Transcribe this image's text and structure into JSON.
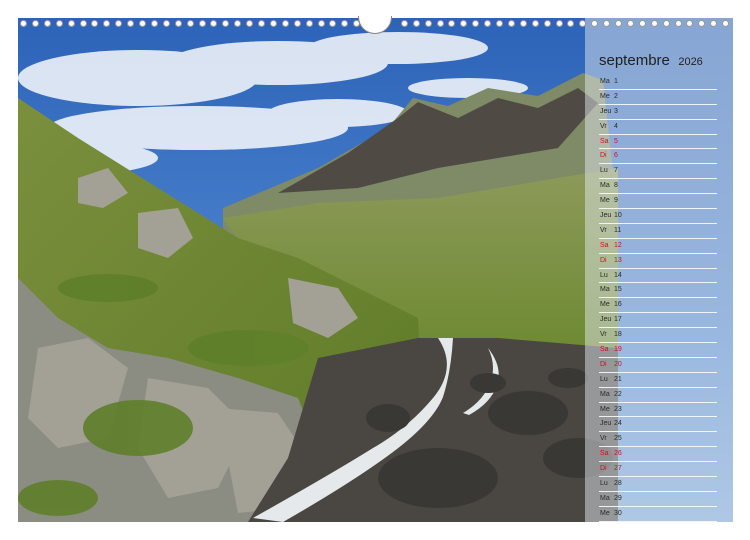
{
  "calendar": {
    "month": "septembre",
    "year": "2026",
    "weekend_color": "#c8141e",
    "text_color": "#2a2a2a",
    "days": [
      {
        "name": "Ma",
        "num": "1",
        "weekend": false
      },
      {
        "name": "Me",
        "num": "2",
        "weekend": false
      },
      {
        "name": "Jeu",
        "num": "3",
        "weekend": false
      },
      {
        "name": "Vr",
        "num": "4",
        "weekend": false
      },
      {
        "name": "Sa",
        "num": "5",
        "weekend": true
      },
      {
        "name": "Di",
        "num": "6",
        "weekend": true
      },
      {
        "name": "Lu",
        "num": "7",
        "weekend": false
      },
      {
        "name": "Ma",
        "num": "8",
        "weekend": false
      },
      {
        "name": "Me",
        "num": "9",
        "weekend": false
      },
      {
        "name": "Jeu",
        "num": "10",
        "weekend": false
      },
      {
        "name": "Vr",
        "num": "11",
        "weekend": false
      },
      {
        "name": "Sa",
        "num": "12",
        "weekend": true
      },
      {
        "name": "Di",
        "num": "13",
        "weekend": true
      },
      {
        "name": "Lu",
        "num": "14",
        "weekend": false
      },
      {
        "name": "Ma",
        "num": "15",
        "weekend": false
      },
      {
        "name": "Me",
        "num": "16",
        "weekend": false
      },
      {
        "name": "Jeu",
        "num": "17",
        "weekend": false
      },
      {
        "name": "Vr",
        "num": "18",
        "weekend": false
      },
      {
        "name": "Sa",
        "num": "19",
        "weekend": true
      },
      {
        "name": "Di",
        "num": "20",
        "weekend": true
      },
      {
        "name": "Lu",
        "num": "21",
        "weekend": false
      },
      {
        "name": "Ma",
        "num": "22",
        "weekend": false
      },
      {
        "name": "Me",
        "num": "23",
        "weekend": false
      },
      {
        "name": "Jeu",
        "num": "24",
        "weekend": false
      },
      {
        "name": "Vr",
        "num": "25",
        "weekend": false
      },
      {
        "name": "Sa",
        "num": "26",
        "weekend": true
      },
      {
        "name": "Di",
        "num": "27",
        "weekend": true
      },
      {
        "name": "Lu",
        "num": "28",
        "weekend": false
      },
      {
        "name": "Ma",
        "num": "29",
        "weekend": false
      },
      {
        "name": "Me",
        "num": "30",
        "weekend": false
      }
    ]
  }
}
